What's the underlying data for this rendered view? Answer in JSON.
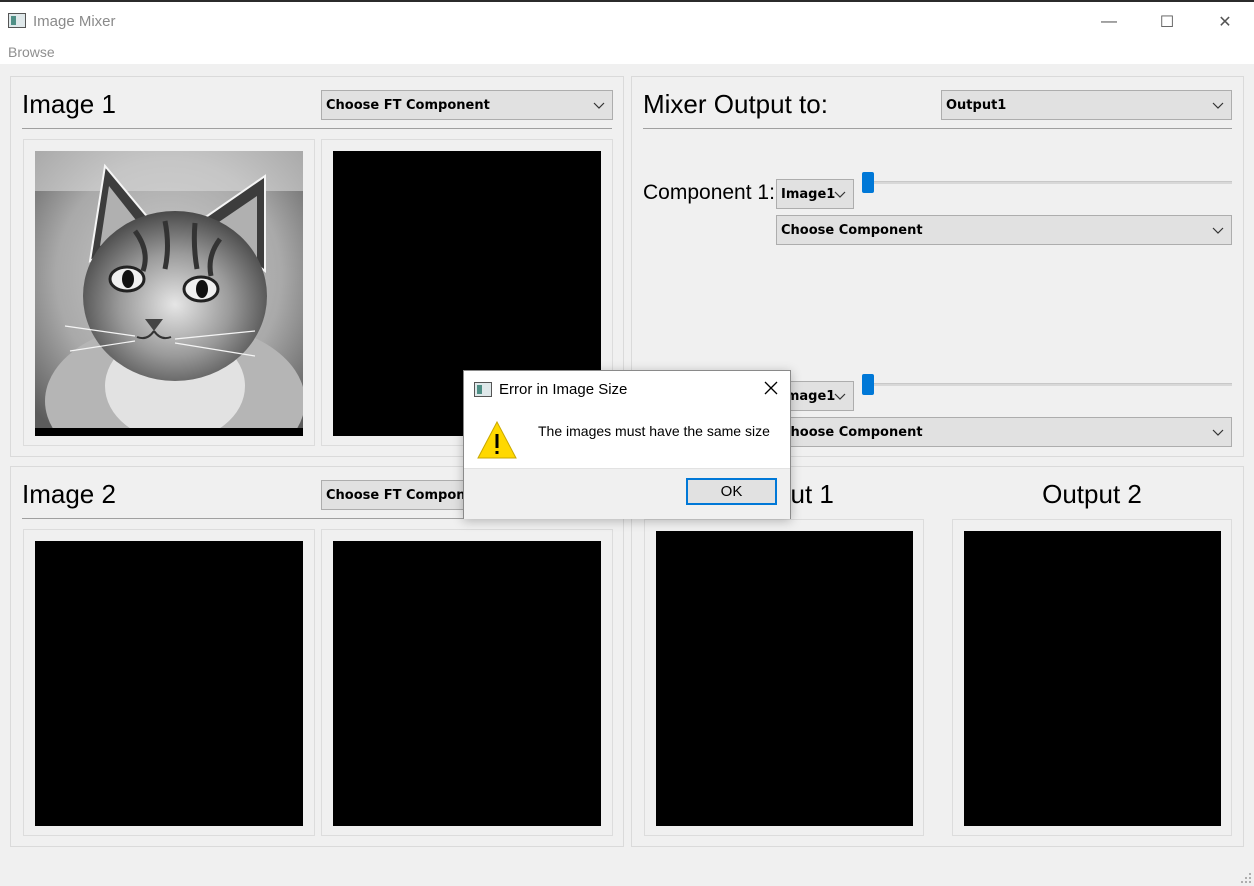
{
  "window": {
    "title": "Image Mixer",
    "minimize_glyph": "—",
    "maximize_glyph": "☐",
    "close_glyph": "✕"
  },
  "menu": {
    "browse_label": "Browse"
  },
  "image1": {
    "title": "Image 1",
    "ft_combo": "Choose FT Component"
  },
  "image2": {
    "title": "Image 2",
    "ft_combo": "Choose FT Component"
  },
  "mixer": {
    "title": "Mixer Output to:",
    "output_combo": "Output1",
    "component1": {
      "label": "Component 1:",
      "image_combo": "Image1",
      "component_combo": "Choose Component",
      "slider_value": 0
    },
    "component2": {
      "image_combo": "Image1",
      "component_combo": "Choose Component",
      "slider_value": 0
    }
  },
  "outputs": {
    "output1_title": "Output 1",
    "output2_title": "Output 2"
  },
  "dialog": {
    "title": "Error in Image Size",
    "message": "The images must have the same size",
    "ok_label": "OK",
    "icon": "warning-icon"
  },
  "colors": {
    "slider_accent": "#0078d7",
    "warning_yellow": "#ffd800"
  }
}
